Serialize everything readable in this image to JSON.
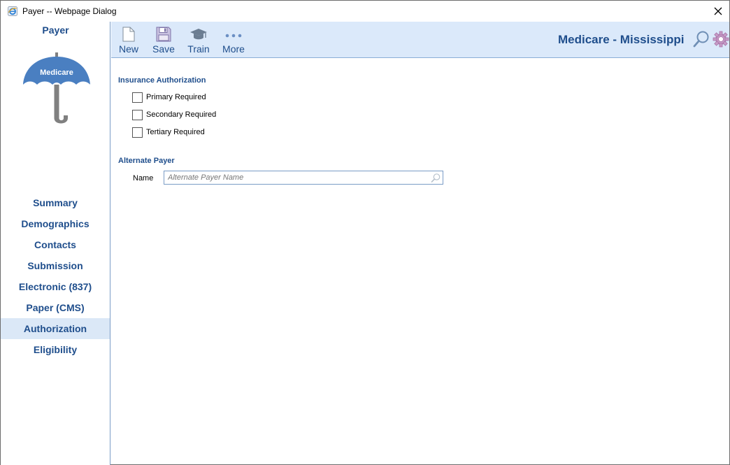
{
  "window": {
    "title": "Payer -- Webpage Dialog"
  },
  "sidebar": {
    "title": "Payer",
    "logo_text": "Medicare",
    "items": [
      {
        "label": "Summary",
        "active": false
      },
      {
        "label": "Demographics",
        "active": false
      },
      {
        "label": "Contacts",
        "active": false
      },
      {
        "label": "Submission",
        "active": false
      },
      {
        "label": "Electronic (837)",
        "active": false
      },
      {
        "label": "Paper (CMS)",
        "active": false
      },
      {
        "label": "Authorization",
        "active": true
      },
      {
        "label": "Eligibility",
        "active": false
      }
    ]
  },
  "toolbar": {
    "new_label": "New",
    "save_label": "Save",
    "train_label": "Train",
    "more_label": "More",
    "payer_name": "Medicare - Mississippi"
  },
  "insurance_authorization": {
    "title": "Insurance Authorization",
    "options": [
      {
        "label": "Primary Required",
        "checked": false
      },
      {
        "label": "Secondary Required",
        "checked": false
      },
      {
        "label": "Tertiary Required",
        "checked": false
      }
    ]
  },
  "alternate_payer": {
    "title": "Alternate Payer",
    "name_label": "Name",
    "name_value": "",
    "name_placeholder": "Alternate Payer Name"
  },
  "colors": {
    "accent": "#1f4e8c",
    "toolbar_bg": "#dbe9fa",
    "active_nav_bg": "#dbe8f7",
    "logo_blue": "#4a7fc1",
    "logo_gray": "#808080"
  },
  "icons": {
    "app": "ie-icon",
    "close": "close-icon",
    "new": "new-document-icon",
    "save": "floppy-disk-icon",
    "train": "graduation-cap-icon",
    "more": "more-dots-icon",
    "search": "search-icon",
    "settings": "gear-icon",
    "logo": "umbrella-icon"
  }
}
